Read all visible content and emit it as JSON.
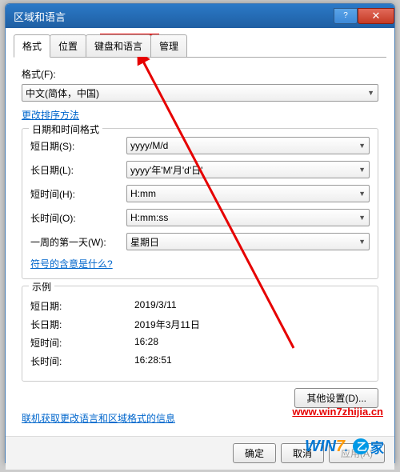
{
  "titlebar": {
    "title": "区域和语言"
  },
  "tabs": {
    "items": [
      {
        "label": "格式"
      },
      {
        "label": "位置"
      },
      {
        "label": "键盘和语言"
      },
      {
        "label": "管理"
      }
    ]
  },
  "format": {
    "label": "格式(F):",
    "value": "中文(简体，中国)",
    "change_sort": "更改排序方法"
  },
  "datetime": {
    "legend": "日期和时间格式",
    "short_date_label": "短日期(S):",
    "short_date_value": "yyyy/M/d",
    "long_date_label": "长日期(L):",
    "long_date_value": "yyyy'年'M'月'd'日'",
    "short_time_label": "短时间(H):",
    "short_time_value": "H:mm",
    "long_time_label": "长时间(O):",
    "long_time_value": "H:mm:ss",
    "first_day_label": "一周的第一天(W):",
    "first_day_value": "星期日",
    "symbols_link": "符号的含意是什么?"
  },
  "examples": {
    "legend": "示例",
    "short_date_label": "短日期:",
    "short_date_value": "2019/3/11",
    "long_date_label": "长日期:",
    "long_date_value": "2019年3月11日",
    "short_time_label": "短时间:",
    "short_time_value": "16:28",
    "long_time_label": "长时间:",
    "long_time_value": "16:28:51"
  },
  "buttons": {
    "other_settings": "其他设置(D)...",
    "ok": "确定",
    "cancel": "取消",
    "apply": "应用(A)"
  },
  "footer_link": "联机获取更改语言和区域格式的信息",
  "watermark": "www.win7zhijia.cn"
}
